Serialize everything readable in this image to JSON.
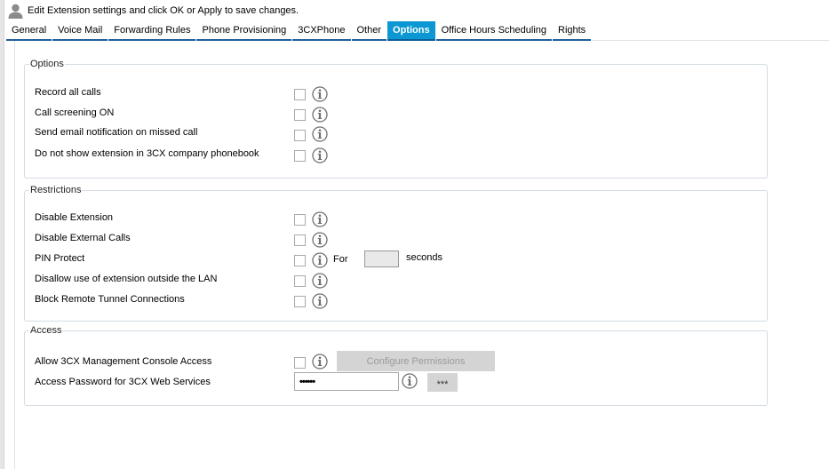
{
  "header": {
    "icon": "user-icon",
    "title": "Edit Extension settings and click OK or Apply to save changes."
  },
  "tabs": [
    {
      "label": "General",
      "active": false
    },
    {
      "label": "Voice Mail",
      "active": false
    },
    {
      "label": "Forwarding Rules",
      "active": false
    },
    {
      "label": "Phone Provisioning",
      "active": false
    },
    {
      "label": "3CXPhone",
      "active": false
    },
    {
      "label": "Other",
      "active": false
    },
    {
      "label": "Options",
      "active": true
    },
    {
      "label": "Office Hours Scheduling",
      "active": false
    },
    {
      "label": "Rights",
      "active": false
    }
  ],
  "options": {
    "legend": "Options",
    "items": [
      {
        "label": "Record all calls",
        "checked": false,
        "icon": "info-icon"
      },
      {
        "label": "Call screening ON",
        "checked": false,
        "icon": "info-icon"
      },
      {
        "label": "Send email notification on missed call",
        "checked": false,
        "icon": "info-icon"
      },
      {
        "label": "Do not show extension in 3CX company phonebook",
        "checked": false,
        "icon": "info-icon"
      }
    ]
  },
  "restrictions": {
    "legend": "Restrictions",
    "items": [
      {
        "label": "Disable Extension",
        "checked": false,
        "icon": "info-icon"
      },
      {
        "label": "Disable External Calls",
        "checked": false,
        "icon": "info-icon"
      },
      {
        "label": "PIN Protect",
        "checked": false,
        "icon": "info-icon"
      },
      {
        "label": "Disallow use of extension outside the LAN",
        "checked": false,
        "icon": "info-icon"
      },
      {
        "label": "Block Remote Tunnel Connections",
        "checked": false,
        "icon": "info-icon"
      }
    ],
    "pin": {
      "for_label": "For",
      "seconds_value": "",
      "seconds_label": "seconds"
    }
  },
  "access": {
    "legend": "Access",
    "console": {
      "label": "Allow 3CX Management Console Access",
      "checked": false,
      "button_label": "Configure Permissions",
      "button_enabled": false
    },
    "password": {
      "label": "Access Password for 3CX Web Services",
      "value": "••••••",
      "reveal_button_label": "***"
    }
  },
  "colors": {
    "active_tab": "#0b97d3",
    "tab_underline": "#1f5f98",
    "group_border": "#d4dce3",
    "disabled_button": "#d4d4d4"
  }
}
